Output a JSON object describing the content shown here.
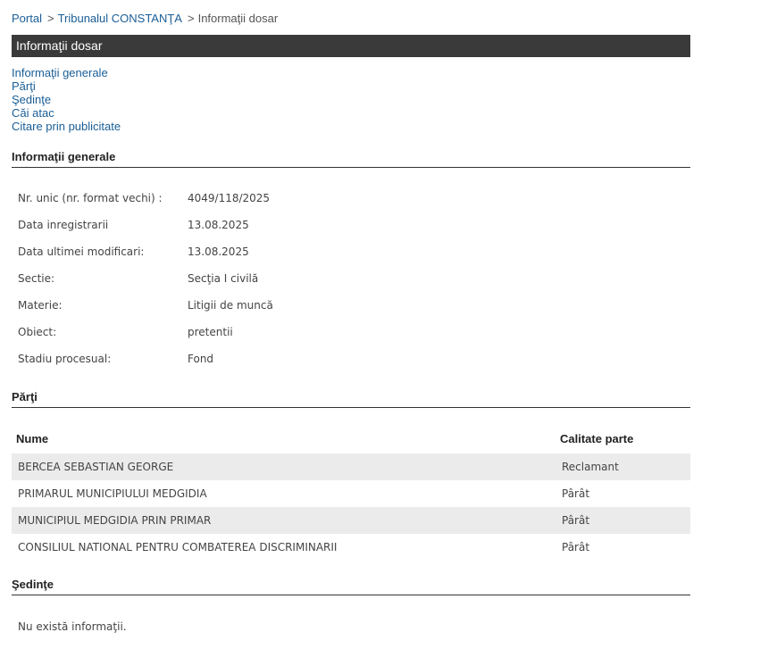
{
  "breadcrumb": {
    "portal": "Portal",
    "court": "Tribunalul CONSTANŢA",
    "current": "Informaţii dosar"
  },
  "page_title": "Informaţii dosar",
  "nav": {
    "items": [
      "Informaţii generale",
      "Părţi",
      "Şedinţe",
      "Căi atac",
      "Citare prin publicitate"
    ]
  },
  "general": {
    "title": "Informaţii generale",
    "rows": [
      {
        "label": "Nr. unic (nr. format vechi) :",
        "value": "4049/118/2025"
      },
      {
        "label": "Data inregistrarii",
        "value": "13.08.2025"
      },
      {
        "label": "Data ultimei modificari:",
        "value": "13.08.2025"
      },
      {
        "label": "Sectie:",
        "value": "Secţia I civilă"
      },
      {
        "label": "Materie:",
        "value": "Litigii de muncă"
      },
      {
        "label": "Obiect:",
        "value": "pretentii"
      },
      {
        "label": "Stadiu procesual:",
        "value": "Fond"
      }
    ]
  },
  "parti": {
    "title": "Părţi",
    "headers": {
      "name": "Nume",
      "role": "Calitate parte"
    },
    "rows": [
      {
        "name": "BERCEA SEBASTIAN GEORGE",
        "role": "Reclamant"
      },
      {
        "name": "PRIMARUL MUNICIPIULUI MEDGIDIA",
        "role": "Pârât"
      },
      {
        "name": "MUNICIPIUL MEDGIDIA PRIN PRIMAR",
        "role": "Pârât"
      },
      {
        "name": "CONSILIUL NATIONAL PENTRU COMBATEREA DISCRIMINARII",
        "role": "Pârât"
      }
    ]
  },
  "sedinte": {
    "title": "Şedinţe",
    "empty": "Nu există informaţii."
  }
}
